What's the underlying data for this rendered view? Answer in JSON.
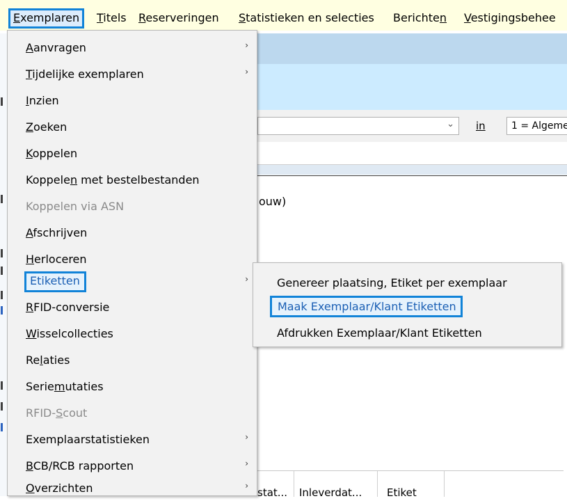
{
  "menubar": {
    "items": [
      {
        "label": "Exemplaren",
        "hotkey": "E",
        "rest": "xemplaren"
      },
      {
        "label": "Titels",
        "hotkey": "T",
        "rest": "itels"
      },
      {
        "label": "Reserveringen",
        "hotkey": "R",
        "rest": "eserveringen"
      },
      {
        "label": "Statistieken en selecties",
        "hotkey": "S",
        "rest": "tatistieken en selecties"
      },
      {
        "label": "Berichten",
        "pre": "Berichte",
        "hotkey": "n",
        "rest": ""
      },
      {
        "label": "Vestigingsbeheer",
        "hotkey": "V",
        "rest": "estigingsbehee"
      }
    ]
  },
  "menu": {
    "items": [
      {
        "pre": "",
        "hotkey": "A",
        "rest": "anvragen",
        "submenu": true,
        "disabled": false
      },
      {
        "pre": "",
        "hotkey": "T",
        "rest": "ijdelijke exemplaren",
        "submenu": true,
        "disabled": false
      },
      {
        "pre": "",
        "hotkey": "I",
        "rest": "nzien",
        "submenu": false,
        "disabled": false
      },
      {
        "pre": "",
        "hotkey": "Z",
        "rest": "oeken",
        "submenu": false,
        "disabled": false
      },
      {
        "pre": "",
        "hotkey": "K",
        "rest": "oppelen",
        "submenu": false,
        "disabled": false
      },
      {
        "pre": "Koppele",
        "hotkey": "n",
        "rest": " met bestelbestanden",
        "submenu": false,
        "disabled": false
      },
      {
        "pre": "Koppelen via ASN",
        "hotkey": "",
        "rest": "",
        "submenu": false,
        "disabled": true
      },
      {
        "pre": "",
        "hotkey": "A",
        "rest": "fschrijven",
        "submenu": false,
        "disabled": false
      },
      {
        "pre": "",
        "hotkey": "H",
        "rest": "erloceren",
        "submenu": false,
        "disabled": false
      },
      {
        "pre": "Etiketten",
        "hotkey": "",
        "rest": "",
        "submenu": true,
        "disabled": false,
        "highlight": true
      },
      {
        "pre": "",
        "hotkey": "R",
        "rest": "FID-conversie",
        "submenu": false,
        "disabled": false
      },
      {
        "pre": "",
        "hotkey": "W",
        "rest": "isselcollecties",
        "submenu": false,
        "disabled": false
      },
      {
        "pre": "Re",
        "hotkey": "l",
        "rest": "aties",
        "submenu": false,
        "disabled": false
      },
      {
        "pre": "Serie",
        "hotkey": "m",
        "rest": "utaties",
        "submenu": false,
        "disabled": false
      },
      {
        "pre": "RFID-",
        "hotkey": "S",
        "rest": "cout",
        "submenu": false,
        "disabled": true
      },
      {
        "pre": "Exemplaarstatistieken",
        "hotkey": "",
        "rest": "",
        "submenu": true,
        "disabled": false
      },
      {
        "pre": "",
        "hotkey": "B",
        "rest": "CB/RCB rapporten",
        "submenu": true,
        "disabled": false
      },
      {
        "pre": "",
        "hotkey": "O",
        "rest": "verzichten",
        "submenu": true,
        "disabled": false
      }
    ]
  },
  "submenu": {
    "items": [
      {
        "label": "Genereer plaatsing, Etiket per exemplaar",
        "highlight": false
      },
      {
        "label": "Maak Exemplaar/Klant Etiketten",
        "highlight": true
      },
      {
        "label": "Afdrukken Exemplaar/Klant Etiketten",
        "highlight": false
      }
    ]
  },
  "background": {
    "search_scope_label": "in",
    "search_scope_value": "1 = Algeme",
    "partial_text": "ouw)",
    "columns": [
      "stat...",
      "Inleverdat...",
      "Etiket"
    ]
  },
  "icons": {
    "submenu_arrow": "chevron-right-icon",
    "combo_arrow": "chevron-down-icon"
  },
  "colors": {
    "menubar_bg": "#ffffe1",
    "highlight_border": "#1183d8",
    "highlight_text": "#1a5fb4",
    "menu_bg": "#f2f2f2"
  }
}
